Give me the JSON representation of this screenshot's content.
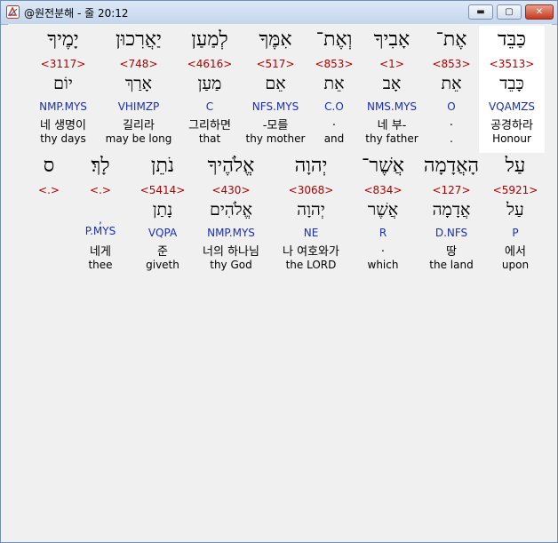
{
  "window": {
    "title": "@원전분해 - 줄 20:12",
    "buttons": {
      "minimize": "▬",
      "maximize": "▢",
      "close": "✕"
    }
  },
  "rows": [
    {
      "words": [
        {
          "hebrew": "כַּבֵּד",
          "strong": "<3513>",
          "lemma": "כָּבֵד",
          "morph": "VQAMZS",
          "korean": "공경하라",
          "english": "Honour",
          "highlight": true
        },
        {
          "hebrew": "אֶת־",
          "strong": "<853>",
          "lemma": "אֵת",
          "morph": "O",
          "korean": ".",
          "english": "."
        },
        {
          "hebrew": "אָבִיךָ",
          "strong": "<1>",
          "lemma": "אָב",
          "morph": "NMS.MYS",
          "korean": "네 부-",
          "english": "thy father"
        },
        {
          "hebrew": "וְאֶת־",
          "strong": "<853>",
          "lemma": "אֵת",
          "morph": "C.O",
          "korean": ".",
          "english": "and"
        },
        {
          "hebrew": "אִמֶּךָ",
          "strong": "<517>",
          "lemma": "אֵם",
          "morph": "NFS.MYS",
          "korean": "-모를",
          "english": "thy mother"
        },
        {
          "hebrew": "לְמַעַן",
          "strong": "<4616>",
          "lemma": "מַעַן",
          "morph": "C",
          "korean": "그리하면",
          "english": "that"
        },
        {
          "hebrew": "יַאֲרִכוּן",
          "strong": "<748>",
          "lemma": "אָרַךְ",
          "morph": "VHIMZP",
          "korean": "길리라",
          "english": "may be long"
        },
        {
          "hebrew": "יָמֶיךָ",
          "strong": "<3117>",
          "lemma": "יוֹם",
          "morph": "NMP.MYS",
          "korean": "네 생명이",
          "english": "thy days"
        }
      ]
    },
    {
      "words": [
        {
          "hebrew": "עַל",
          "strong": "<5921>",
          "lemma": "עַל",
          "morph": "P",
          "korean": "에서",
          "english": "upon"
        },
        {
          "hebrew": "הָאֲדָמָה",
          "strong": "<127>",
          "lemma": "אֲדָמָה",
          "morph": "D.NFS",
          "korean": "땅",
          "english": "the land"
        },
        {
          "hebrew": "אֲשֶׁר־",
          "strong": "<834>",
          "lemma": "אֲשֶׁר",
          "morph": "R",
          "korean": ".",
          "english": "which"
        },
        {
          "hebrew": "יְהוָה",
          "strong": "<3068>",
          "lemma": "יְהוָה",
          "morph": "NE",
          "korean": "나 여호와가",
          "english": "the LORD"
        },
        {
          "hebrew": "אֱלֹהֶיךָ",
          "strong": "<430>",
          "lemma": "אֱלֹהִים",
          "morph": "NMP.MYS",
          "korean": "너의 하나님",
          "english": "thy God"
        },
        {
          "hebrew": "נֹתֵן",
          "strong": "<5414>",
          "lemma": "נָתַן",
          "morph": "VQPA",
          "korean": "준",
          "english": "giveth"
        },
        {
          "hebrew": "לָךְ׃",
          "strong": "<.>",
          "lemma": "",
          "morph": ",\nP.MYS",
          "korean": "네게",
          "english": "thee"
        },
        {
          "hebrew": "ס",
          "strong": "<.>",
          "lemma": "",
          "morph": "",
          "korean": "",
          "english": ""
        }
      ]
    }
  ]
}
